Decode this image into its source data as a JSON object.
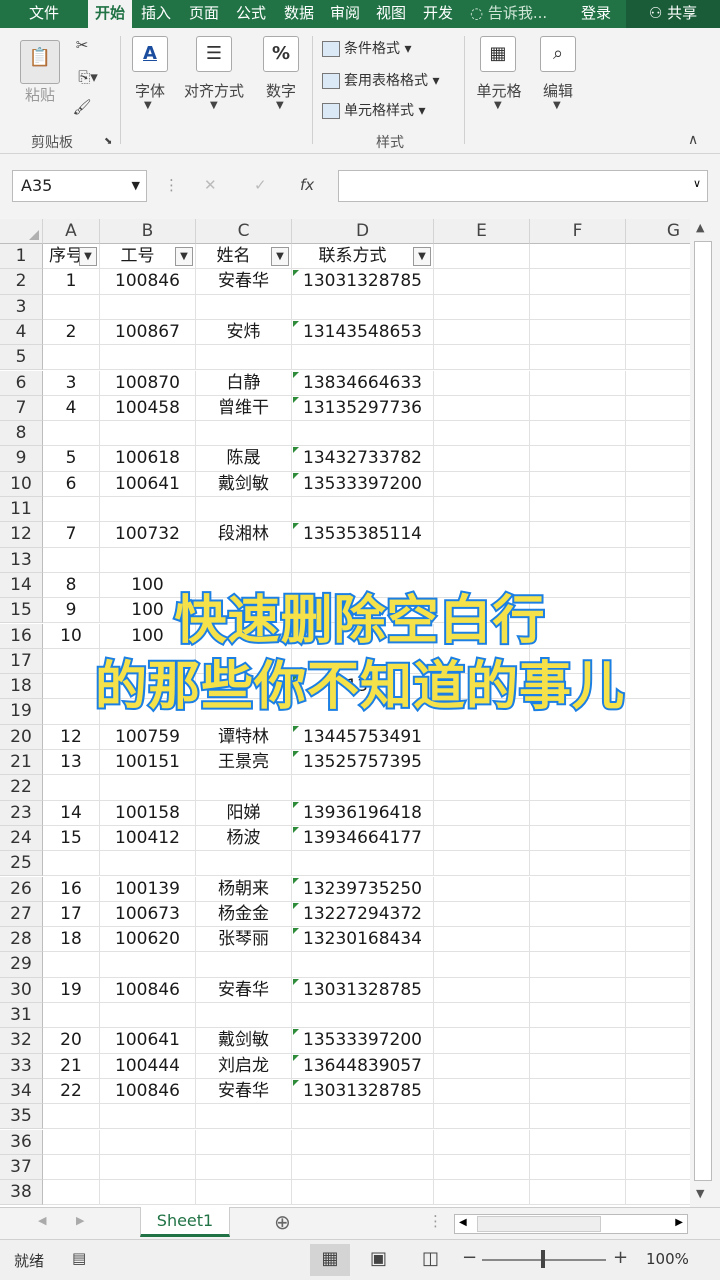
{
  "tabs": [
    "文件",
    "开始",
    "插入",
    "页面布",
    "公式",
    "数据",
    "审阅",
    "视图",
    "开发"
  ],
  "tell_me": "告诉我...",
  "login": "登录",
  "share": "共享",
  "ribbon": {
    "paste": "粘贴",
    "clipboard": "剪贴板",
    "font": "字体",
    "align": "对齐方式",
    "number": "数字",
    "cond_format": "条件格式",
    "table_format": "套用表格格式",
    "cell_style": "单元格样式",
    "styles": "样式",
    "cells": "单元格",
    "editing": "编辑"
  },
  "formula_bar": {
    "name_box": "A35",
    "fx": "fx",
    "value": ""
  },
  "columns": [
    "A",
    "B",
    "C",
    "D",
    "E",
    "F",
    "G"
  ],
  "headers": [
    "序号",
    "工号",
    "姓名",
    "联系方式"
  ],
  "rows": [
    {
      "n": "2",
      "a": "1",
      "b": "100846",
      "c": "安春华",
      "d": "13031328785"
    },
    {
      "n": "3",
      "a": "",
      "b": "",
      "c": "",
      "d": ""
    },
    {
      "n": "4",
      "a": "2",
      "b": "100867",
      "c": "安炜",
      "d": "13143548653"
    },
    {
      "n": "5",
      "a": "",
      "b": "",
      "c": "",
      "d": ""
    },
    {
      "n": "6",
      "a": "3",
      "b": "100870",
      "c": "白静",
      "d": "13834664633"
    },
    {
      "n": "7",
      "a": "4",
      "b": "100458",
      "c": "曾维干",
      "d": "13135297736"
    },
    {
      "n": "8",
      "a": "",
      "b": "",
      "c": "",
      "d": ""
    },
    {
      "n": "9",
      "a": "5",
      "b": "100618",
      "c": "陈晟",
      "d": "13432733782"
    },
    {
      "n": "10",
      "a": "6",
      "b": "100641",
      "c": "戴剑敏",
      "d": "13533397200"
    },
    {
      "n": "11",
      "a": "",
      "b": "",
      "c": "",
      "d": ""
    },
    {
      "n": "12",
      "a": "7",
      "b": "100732",
      "c": "段湘林",
      "d": "13535385114"
    },
    {
      "n": "13",
      "a": "",
      "b": "",
      "c": "",
      "d": ""
    },
    {
      "n": "14",
      "a": "8",
      "b": "100",
      "c": "",
      "d": ""
    },
    {
      "n": "15",
      "a": "9",
      "b": "100",
      "c": "",
      "d": ""
    },
    {
      "n": "16",
      "a": "10",
      "b": "100",
      "c": "",
      "d": ""
    },
    {
      "n": "17",
      "a": "",
      "b": "",
      "c": "",
      "d": ""
    },
    {
      "n": "18",
      "a": "",
      "b": "",
      "c": "",
      "d": "133"
    },
    {
      "n": "19",
      "a": "",
      "b": "",
      "c": "",
      "d": ""
    },
    {
      "n": "20",
      "a": "12",
      "b": "100759",
      "c": "谭特林",
      "d": "13445753491"
    },
    {
      "n": "21",
      "a": "13",
      "b": "100151",
      "c": "王景亮",
      "d": "13525757395"
    },
    {
      "n": "22",
      "a": "",
      "b": "",
      "c": "",
      "d": ""
    },
    {
      "n": "23",
      "a": "14",
      "b": "100158",
      "c": "阳娣",
      "d": "13936196418"
    },
    {
      "n": "24",
      "a": "15",
      "b": "100412",
      "c": "杨波",
      "d": "13934664177"
    },
    {
      "n": "25",
      "a": "",
      "b": "",
      "c": "",
      "d": ""
    },
    {
      "n": "26",
      "a": "16",
      "b": "100139",
      "c": "杨朝来",
      "d": "13239735250"
    },
    {
      "n": "27",
      "a": "17",
      "b": "100673",
      "c": "杨金金",
      "d": "13227294372"
    },
    {
      "n": "28",
      "a": "18",
      "b": "100620",
      "c": "张琴丽",
      "d": "13230168434"
    },
    {
      "n": "29",
      "a": "",
      "b": "",
      "c": "",
      "d": ""
    },
    {
      "n": "30",
      "a": "19",
      "b": "100846",
      "c": "安春华",
      "d": "13031328785"
    },
    {
      "n": "31",
      "a": "",
      "b": "",
      "c": "",
      "d": ""
    },
    {
      "n": "32",
      "a": "20",
      "b": "100641",
      "c": "戴剑敏",
      "d": "13533397200"
    },
    {
      "n": "33",
      "a": "21",
      "b": "100444",
      "c": "刘启龙",
      "d": "13644839057"
    },
    {
      "n": "34",
      "a": "22",
      "b": "100846",
      "c": "安春华",
      "d": "13031328785"
    },
    {
      "n": "35",
      "a": "",
      "b": "",
      "c": "",
      "d": ""
    },
    {
      "n": "36",
      "a": "",
      "b": "",
      "c": "",
      "d": ""
    },
    {
      "n": "37",
      "a": "",
      "b": "",
      "c": "",
      "d": ""
    },
    {
      "n": "38",
      "a": "",
      "b": "",
      "c": "",
      "d": ""
    }
  ],
  "overlay": {
    "line1": "快速删除空白行",
    "line2": "的那些你不知道的事儿"
  },
  "sheet_tab": "Sheet1",
  "status": {
    "ready": "就绪",
    "zoom": "100%"
  }
}
